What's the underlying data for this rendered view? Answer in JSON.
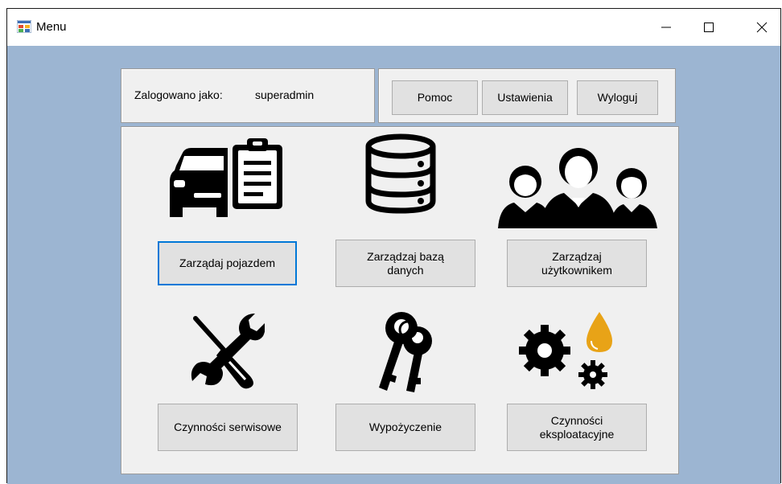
{
  "window": {
    "title": "Menu"
  },
  "header": {
    "logged_in_label": "Zalogowano jako:",
    "username": "superadmin",
    "buttons": {
      "help": "Pomoc",
      "settings": "Ustawienia",
      "logout": "Wyloguj"
    }
  },
  "menu": {
    "manage_vehicle": "Zarządaj pojazdem",
    "manage_database": "Zarządzaj bazą\ndanych",
    "manage_user": "Zarządzaj\nużytkownikem",
    "service_tasks": "Czynności serwisowe",
    "rental": "Wypożyczenie",
    "operational_tasks": "Czynności\neksploatacyjne"
  },
  "colors": {
    "window_bg": "#9cb5d2",
    "panel_bg": "#f0f0f0",
    "button_bg": "#e1e1e1",
    "focus_border": "#0078d7",
    "oil_drop": "#e8a317"
  },
  "icons": [
    "car-clipboard-icon",
    "database-icon",
    "users-icon",
    "tools-icon",
    "keys-icon",
    "gears-oil-icon"
  ]
}
